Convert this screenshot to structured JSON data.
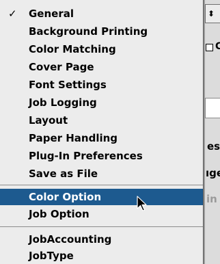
{
  "menu": {
    "items_group1": [
      {
        "label": "General",
        "checked": true
      },
      {
        "label": "Background Printing"
      },
      {
        "label": "Color Matching"
      },
      {
        "label": "Cover Page"
      },
      {
        "label": "Font Settings"
      },
      {
        "label": "Job Logging"
      },
      {
        "label": "Layout"
      },
      {
        "label": "Paper Handling"
      },
      {
        "label": "Plug-In Preferences"
      },
      {
        "label": "Save as File"
      }
    ],
    "items_group2": [
      {
        "label": "Color Option",
        "highlighted": true
      },
      {
        "label": "Job Option"
      }
    ],
    "items_group3": [
      {
        "label": "JobAccounting"
      },
      {
        "label": "JobType"
      }
    ],
    "check_glyph": "✓"
  },
  "background": {
    "popup_arrow": "⬍",
    "checkbox_label_fragment": "C",
    "text_fragment_1": "es",
    "text_fragment_2": "ıge",
    "text_fragment_3": "in"
  },
  "colors": {
    "highlight": "#1d5a8f",
    "menu_background": "#ececec"
  }
}
